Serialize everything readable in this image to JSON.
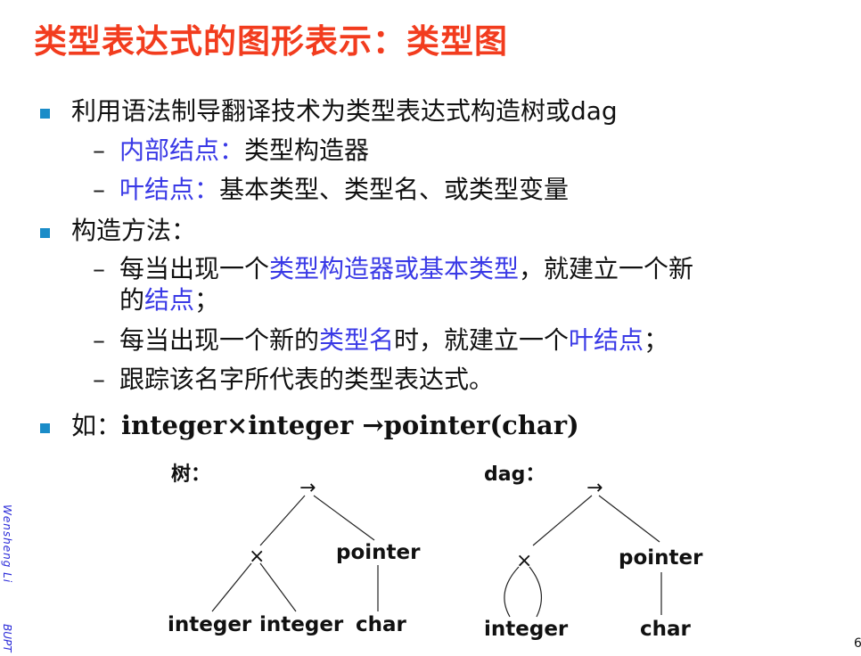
{
  "title": "类型表达式的图形表示：类型图",
  "bullets": {
    "b1": {
      "text": "利用语法制导翻译技术为类型表达式构造树或dag"
    },
    "b1_sub1": {
      "label": "内部结点：",
      "text": "类型构造器"
    },
    "b1_sub2": {
      "label": "叶结点：",
      "text": "基本类型、类型名、或类型变量"
    },
    "b2": {
      "text": "构造方法："
    },
    "b2_sub1": {
      "p1": "每当出现一个",
      "p2": "类型构造器或基本类型",
      "p3": "，就建立一个新",
      "p4": "的",
      "p5": "结点",
      "p6": "；"
    },
    "b2_sub2": {
      "p1": "每当出现一个新的",
      "p2": "类型名",
      "p3": "时，就建立一个",
      "p4": "叶结点",
      "p5": "；"
    },
    "b2_sub3": {
      "text": "跟踪该名字所代表的类型表达式。"
    },
    "b3": {
      "prefix": "如：",
      "expr": "integer×integer →pointer(char)"
    }
  },
  "diagrams": {
    "tree": {
      "label": "树：",
      "root": "→",
      "times": "×",
      "pointer": "pointer",
      "leaf1": "integer",
      "leaf2": "integer",
      "leaf3": "char"
    },
    "dag": {
      "label": "dag：",
      "root": "→",
      "times": "×",
      "pointer": "pointer",
      "leaf1": "integer",
      "leaf3": "char"
    }
  },
  "footer": {
    "author": "Wensheng Li",
    "org": "BUPT",
    "page": "6"
  },
  "colors": {
    "title": "#f23c1e",
    "highlight": "#3a3ae6",
    "bullet": "#1a8cc8"
  }
}
